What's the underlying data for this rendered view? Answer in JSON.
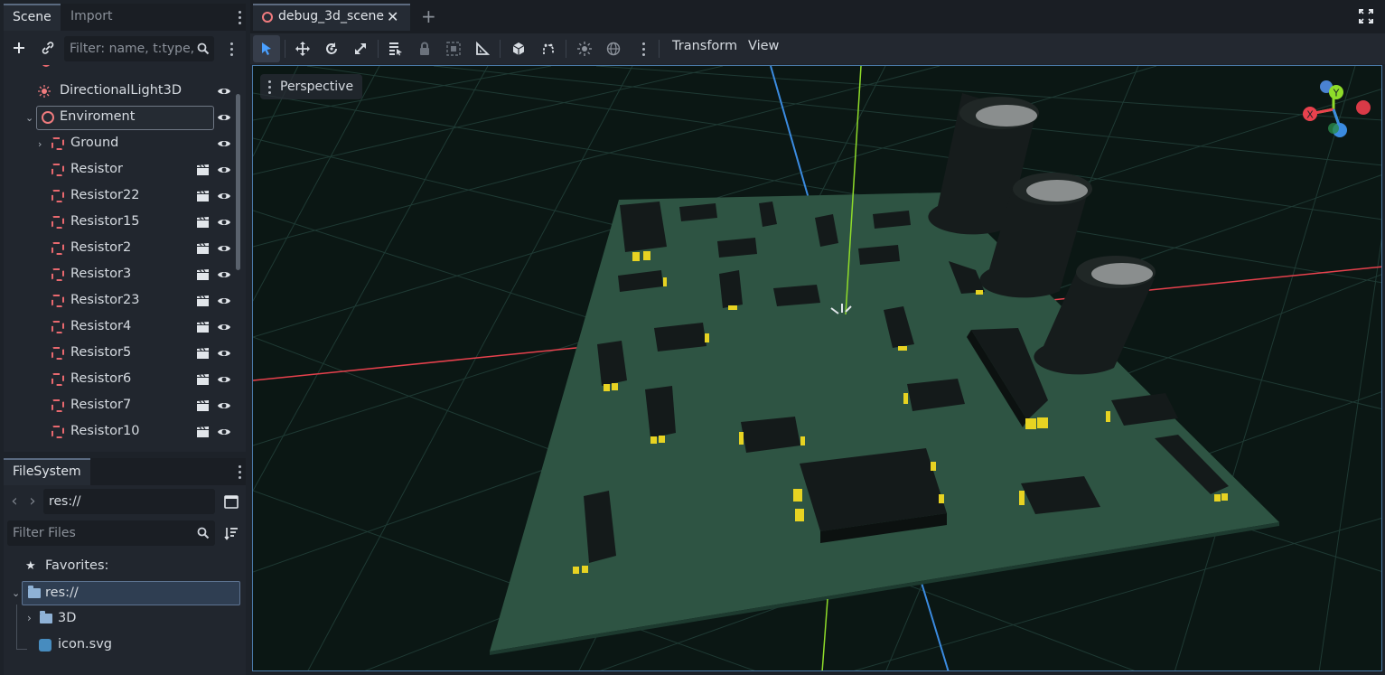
{
  "scene_dock": {
    "tabs": [
      "Scene",
      "Import"
    ],
    "filter_placeholder": "Filter: name, t:type,",
    "nodes": [
      {
        "label": "DirectionalLight3D",
        "icon": "light-icon"
      },
      {
        "label": "Enviroment",
        "icon": "node3d-icon"
      },
      {
        "label": "Ground",
        "icon": "mesh-icon"
      },
      {
        "label": "Resistor",
        "icon": "mesh-icon"
      },
      {
        "label": "Resistor22",
        "icon": "mesh-icon"
      },
      {
        "label": "Resistor15",
        "icon": "mesh-icon"
      },
      {
        "label": "Resistor2",
        "icon": "mesh-icon"
      },
      {
        "label": "Resistor3",
        "icon": "mesh-icon"
      },
      {
        "label": "Resistor23",
        "icon": "mesh-icon"
      },
      {
        "label": "Resistor4",
        "icon": "mesh-icon"
      },
      {
        "label": "Resistor5",
        "icon": "mesh-icon"
      },
      {
        "label": "Resistor6",
        "icon": "mesh-icon"
      },
      {
        "label": "Resistor7",
        "icon": "mesh-icon"
      },
      {
        "label": "Resistor10",
        "icon": "mesh-icon"
      }
    ]
  },
  "filesystem_dock": {
    "tab": "FileSystem",
    "path": "res://",
    "filter_placeholder": "Filter Files",
    "favorites_label": "Favorites:",
    "items": [
      {
        "label": "res://",
        "icon": "folder-icon"
      },
      {
        "label": "3D",
        "icon": "folder-icon"
      },
      {
        "label": "icon.svg",
        "icon": "image-icon"
      }
    ]
  },
  "editor": {
    "scene_tab": "debug_3d_scene",
    "menus": {
      "transform": "Transform",
      "view": "View"
    },
    "viewport_mode": "Perspective",
    "gizmo_axes": {
      "x": "X",
      "y": "Y"
    }
  },
  "colors": {
    "board": "#2e5443",
    "axis_x": "#e8414d",
    "axis_y": "#8fdc2a",
    "axis_z": "#3b8be0",
    "selection": "#4b7aa8"
  }
}
